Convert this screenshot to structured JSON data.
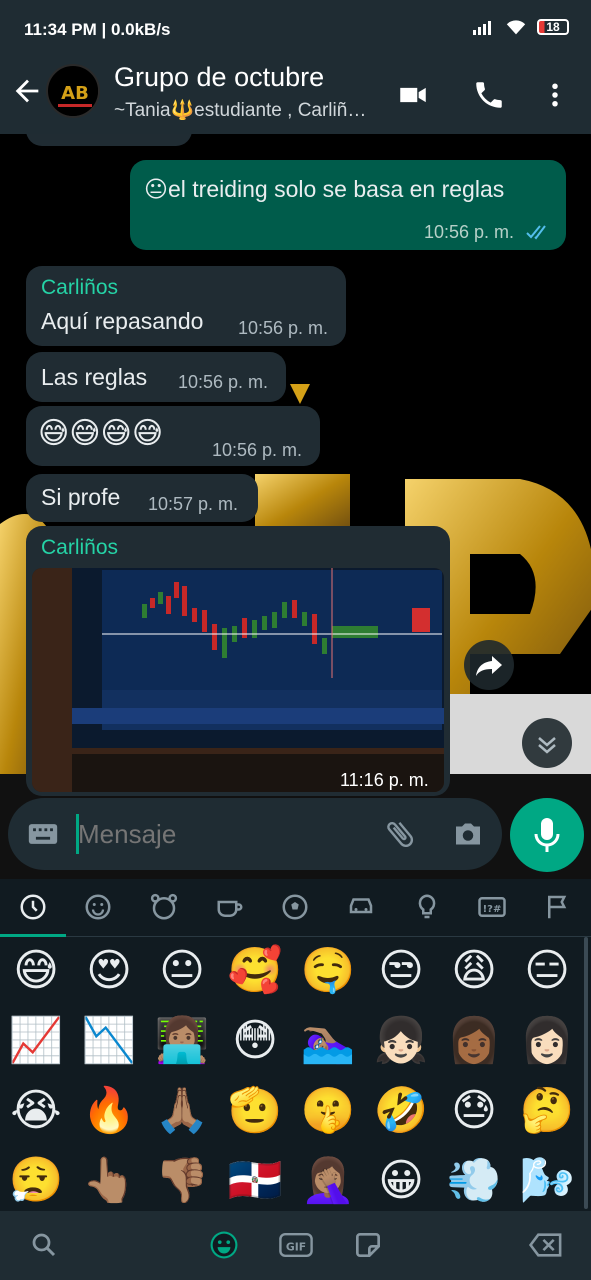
{
  "status": {
    "time": "11:34 PM | 0.0kB/s",
    "battery": "18"
  },
  "header": {
    "title": "Grupo de octubre",
    "subtitle": "~Tania🔱estudiante , Carliñ…",
    "avatar_text": "AB"
  },
  "messages": [
    {
      "type": "out",
      "text": "😐el treiding solo se basa en reglas",
      "time": "10:56 p. m."
    },
    {
      "type": "in",
      "sender": "Carliños",
      "text": "Aquí repasando",
      "time": "10:56 p. m."
    },
    {
      "type": "in",
      "text": "Las reglas",
      "time": "10:56 p. m."
    },
    {
      "type": "in",
      "text": "😅😅😅😅",
      "time": "10:56 p. m."
    },
    {
      "type": "in",
      "text": "Si profe",
      "time": "10:57 p. m."
    },
    {
      "type": "in-image",
      "sender": "Carliños",
      "time": "11:16 p. m."
    }
  ],
  "composer": {
    "placeholder": "Mensaje"
  },
  "emoji_categories": [
    "recent-icon",
    "smileys-icon",
    "animals-icon",
    "food-icon",
    "activity-icon",
    "travel-icon",
    "objects-icon",
    "symbols-icon",
    "flags-icon"
  ],
  "emoji_rows": [
    [
      "😅",
      "😍",
      "😐",
      "🥰",
      "🤤",
      "😒",
      "😩",
      "😑"
    ],
    [
      "📈",
      "📉",
      "👩🏽‍💻",
      "😳",
      "🏊🏽‍♀️",
      "👧🏻",
      "👩🏾",
      "👩🏻"
    ],
    [
      "😭",
      "🔥",
      "🙏🏽",
      "🫡",
      "🤫",
      "🤣",
      "😓",
      "🤔"
    ],
    [
      "😮‍💨",
      "👆🏽",
      "👎🏽",
      "🇩🇴",
      "🤦🏽‍♀️",
      "😀",
      "💨",
      "🌬️"
    ]
  ],
  "colors": {
    "accent": "#00a884",
    "sender": "#25d3a6",
    "out_bubble": "#005c4b",
    "in_bubble": "#202c33"
  }
}
